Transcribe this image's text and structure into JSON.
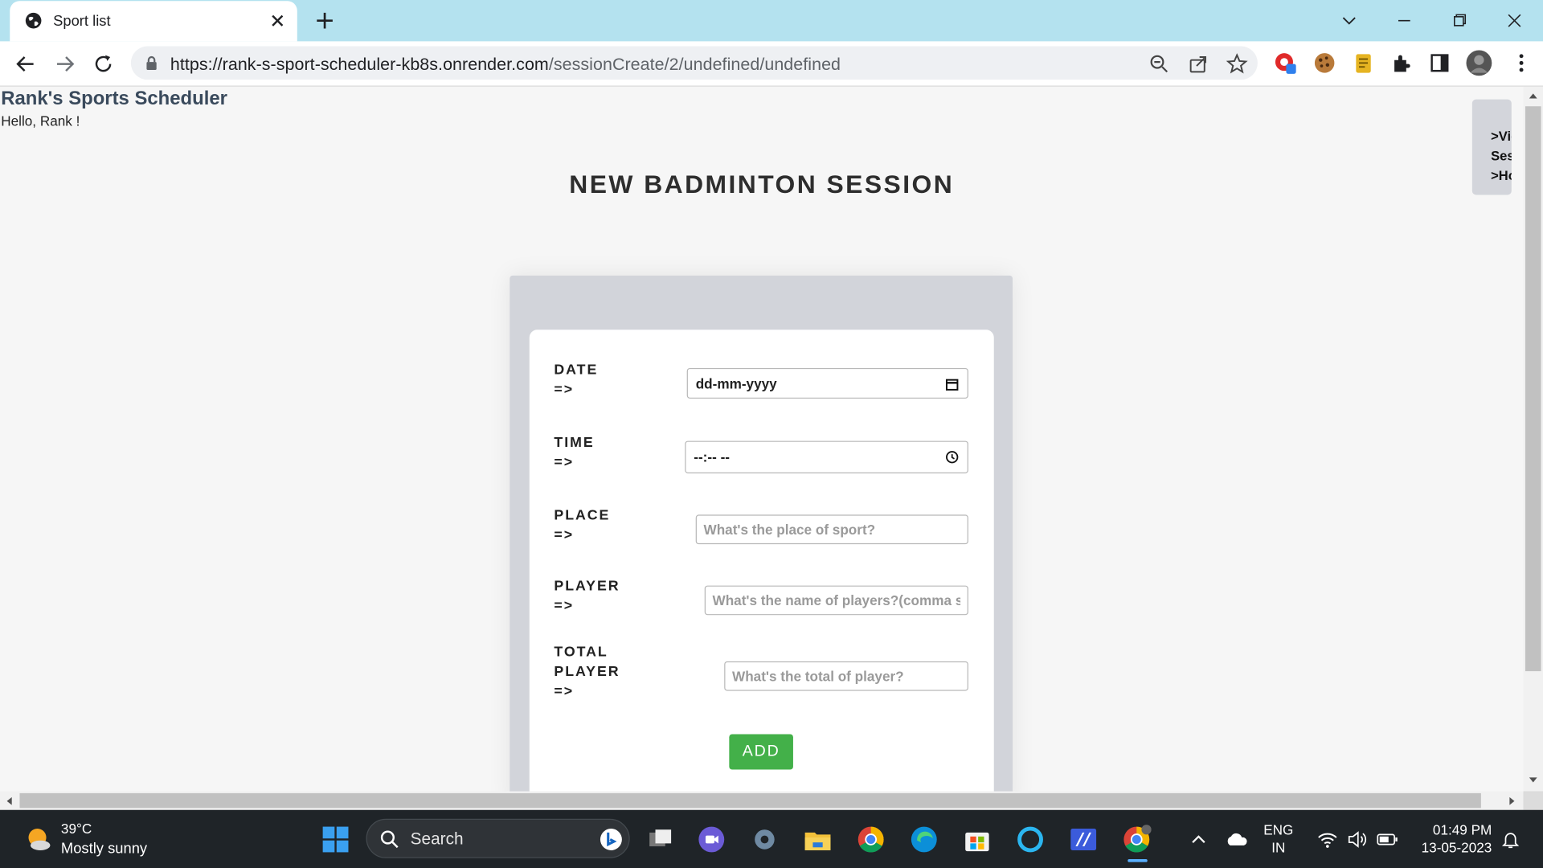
{
  "browser": {
    "tab_title": "Sport list",
    "url_domain": "https://rank-s-sport-scheduler-kb8s.onrender.com",
    "url_path": "/sessionCreate/2/undefined/undefined"
  },
  "page": {
    "app_title": "Rank's Sports Scheduler",
    "greeting": "Hello, Rank !",
    "side_menu": {
      "item1_line1": ">Viev",
      "item1_line2": "Sessi",
      "item2": ">Hon"
    },
    "heading": "NEW BADMINTON SESSION"
  },
  "form": {
    "date_label": "DATE",
    "date_arrow": "=>",
    "date_value": "dd-mm-yyyy",
    "time_label": "TIME",
    "time_arrow": "=>",
    "time_value": "--:-- --",
    "place_label": "PLACE",
    "place_arrow": "=>",
    "place_placeholder": "What's the place of sport?",
    "player_label": "PLAYER",
    "player_arrow": "=>",
    "player_placeholder": "What's the name of players?(comma sap",
    "total_label_1": "TOTAL",
    "total_label_2": "PLAYER",
    "total_arrow": "=>",
    "total_placeholder": "What's the total of player?",
    "add_button": "ADD"
  },
  "taskbar": {
    "temperature": "39°C",
    "weather": "Mostly sunny",
    "search_label": "Search",
    "language_1": "ENG",
    "language_2": "IN",
    "time": "01:49 PM",
    "date": "13-05-2023"
  },
  "colors": {
    "tabbar": "#b4e2ef",
    "add_button": "#43b049",
    "card_outer": "#d2d4da",
    "taskbar": "#1f2428"
  }
}
